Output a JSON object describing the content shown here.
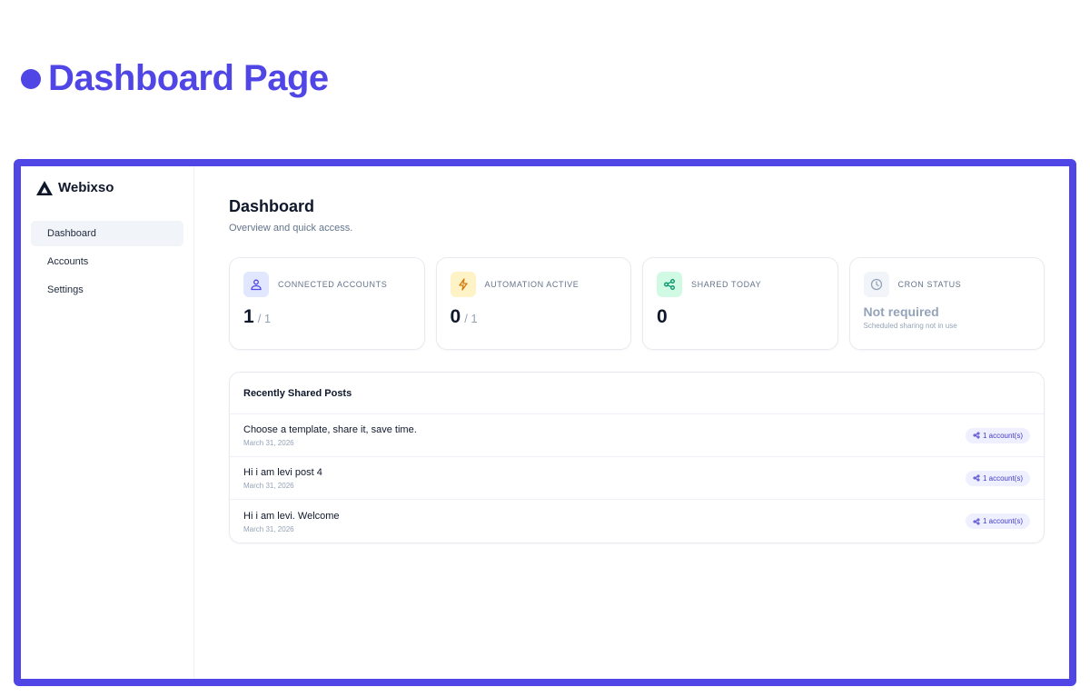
{
  "page_heading": "Dashboard Page",
  "colors": {
    "accent": "#4f46e5"
  },
  "sidebar": {
    "brand": "Webixso",
    "items": [
      {
        "label": "Dashboard",
        "active": true
      },
      {
        "label": "Accounts",
        "active": false
      },
      {
        "label": "Settings",
        "active": false
      }
    ]
  },
  "main": {
    "title": "Dashboard",
    "subtitle": "Overview and quick access.",
    "stats": {
      "connected": {
        "label": "CONNECTED ACCOUNTS",
        "value": "1",
        "total": "/ 1",
        "icon": "users-icon"
      },
      "automation": {
        "label": "AUTOMATION ACTIVE",
        "value": "0",
        "total": "/ 1",
        "icon": "lightning-icon"
      },
      "shared": {
        "label": "SHARED TODAY",
        "value": "0",
        "icon": "share-icon"
      },
      "cron": {
        "label": "CRON STATUS",
        "status": "Not required",
        "note": "Scheduled sharing not in use",
        "icon": "clock-icon"
      }
    },
    "posts": {
      "title": "Recently Shared Posts",
      "items": [
        {
          "title": "Choose a template, share it, save time.",
          "date": "March 31, 2026",
          "badge": "1 account(s)"
        },
        {
          "title": "Hi i am levi post 4",
          "date": "March 31, 2026",
          "badge": "1 account(s)"
        },
        {
          "title": "Hi i am levi. Welcome",
          "date": "March 31, 2026",
          "badge": "1 account(s)"
        }
      ]
    }
  }
}
